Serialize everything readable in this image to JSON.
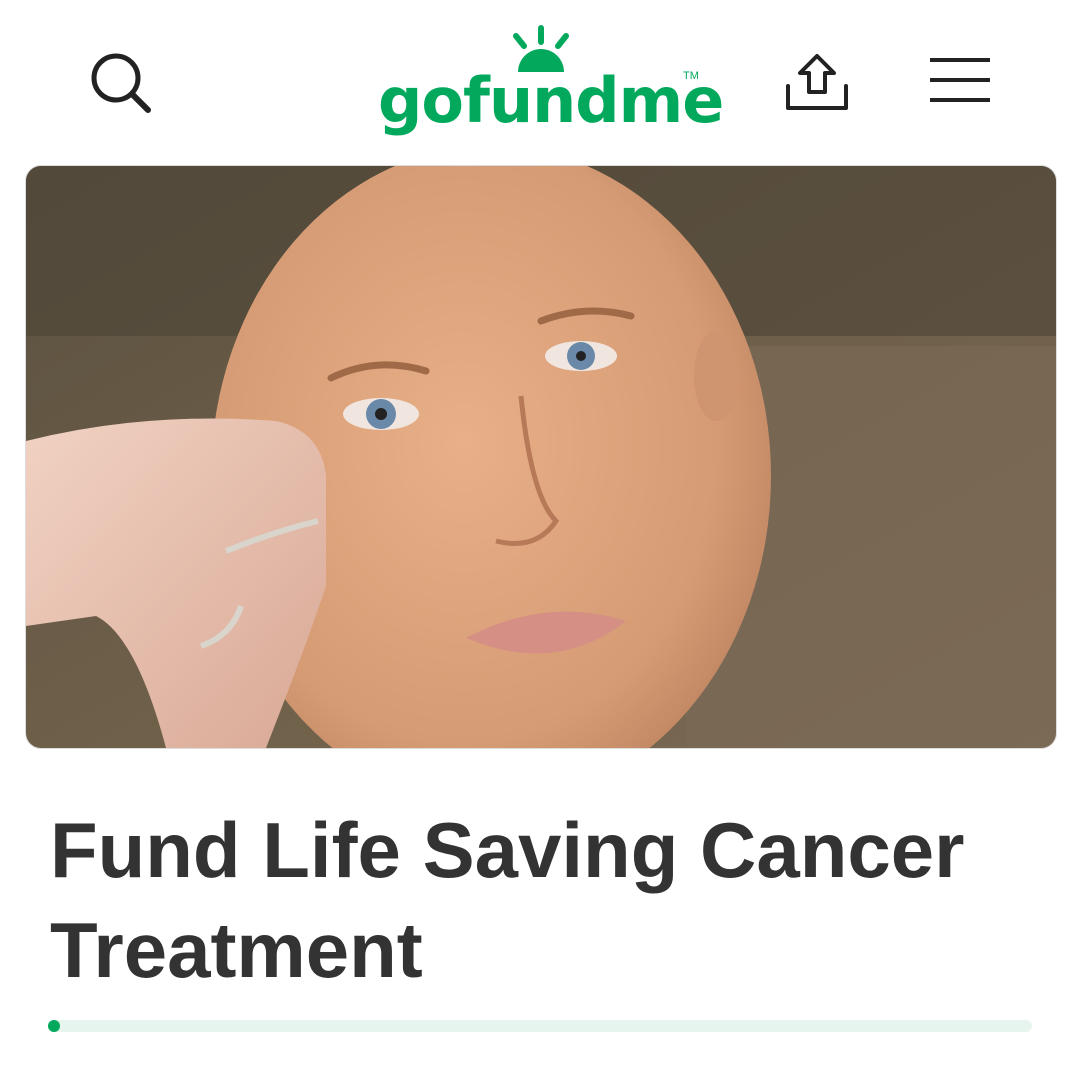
{
  "header": {
    "logo_text": "gofundme",
    "logo_tm": "TM",
    "icons": [
      "search-icon",
      "share-upload-icon",
      "hamburger-menu-icon"
    ]
  },
  "campaign": {
    "title": "Fund Life Saving Cancer Treatment",
    "progress_fraction": 0.01
  },
  "colors": {
    "brand": "#02a95c",
    "title": "#333333",
    "progress_track": "#e6f5ee"
  }
}
